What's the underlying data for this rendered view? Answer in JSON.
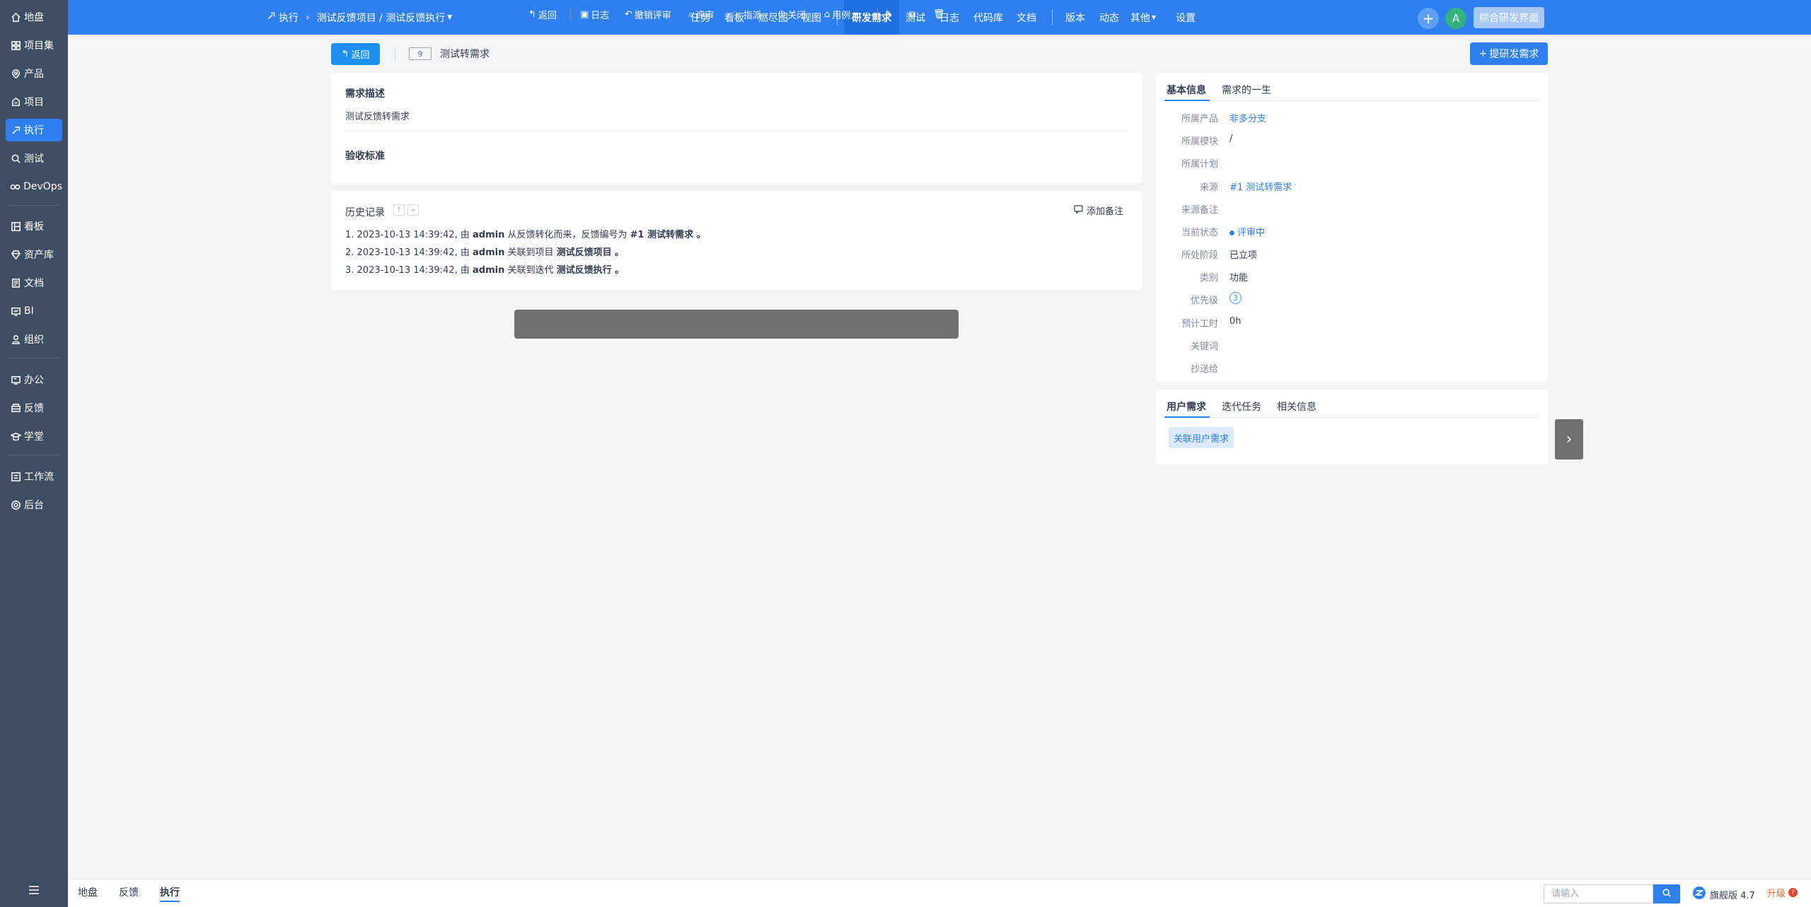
{
  "sidebar": {
    "items": [
      {
        "label": "地盘",
        "icon": "home-icon"
      },
      {
        "label": "项目集",
        "icon": "program-icon"
      },
      {
        "label": "产品",
        "icon": "product-icon"
      },
      {
        "label": "项目",
        "icon": "project-icon"
      },
      {
        "label": "执行",
        "icon": "execution-icon",
        "active": true
      },
      {
        "label": "测试",
        "icon": "test-icon"
      },
      {
        "label": "DevOps",
        "icon": "devops-icon"
      },
      {
        "label": "看板",
        "icon": "kanban-icon"
      },
      {
        "label": "资产库",
        "icon": "asset-icon"
      },
      {
        "label": "文档",
        "icon": "doc-icon"
      },
      {
        "label": "BI",
        "icon": "bi-icon"
      },
      {
        "label": "组织",
        "icon": "org-icon"
      },
      {
        "label": "办公",
        "icon": "office-icon"
      },
      {
        "label": "反馈",
        "icon": "feedback-icon"
      },
      {
        "label": "学堂",
        "icon": "academy-icon"
      },
      {
        "label": "工作流",
        "icon": "workflow-icon"
      },
      {
        "label": "后台",
        "icon": "admin-icon"
      }
    ]
  },
  "header": {
    "breadcrumb": {
      "module": "执行",
      "path": "测试反馈项目 / 测试反馈执行"
    },
    "nav": [
      "任务",
      "看板",
      "燃尽图",
      "视图",
      "研发需求",
      "测试",
      "日志",
      "代码库",
      "文档",
      "版本",
      "动态",
      "其他",
      "设置"
    ],
    "active_nav": "研发需求",
    "avatar_letter": "A",
    "switch_label": "综合研发界面"
  },
  "toolbar": {
    "back_label": "返回",
    "story_id": "9",
    "story_title": "测试转需求",
    "create_label": "提研发需求"
  },
  "story": {
    "desc_title": "需求描述",
    "desc_text": "测试反馈转需求",
    "verify_title": "验收标准"
  },
  "history": {
    "title": "历史记录",
    "add_note": "添加备注",
    "entries": [
      {
        "prefix": "1. 2023-10-13 14:39:42, 由 ",
        "actor": "admin",
        "action": " 从反馈转化而来，反馈编号为 ",
        "object": "#1 测试转需求 。"
      },
      {
        "prefix": "2. 2023-10-13 14:39:42, 由 ",
        "actor": "admin",
        "action": " 关联到项目 ",
        "object": "测试反馈项目 。"
      },
      {
        "prefix": "3. 2023-10-13 14:39:42, 由 ",
        "actor": "admin",
        "action": " 关联到迭代 ",
        "object": "测试反馈执行 。"
      }
    ]
  },
  "actions": {
    "back": "返回",
    "log": "日志",
    "revoke_review": "撤销评审",
    "review": "评审",
    "assign": "指派",
    "close": "关闭",
    "case": "用例"
  },
  "info": {
    "tabs": [
      "基本信息",
      "需求的一生"
    ],
    "fields": [
      {
        "label": "所属产品",
        "value": "非多分支",
        "type": "link"
      },
      {
        "label": "所属模块",
        "value": "/",
        "type": "text"
      },
      {
        "label": "所属计划",
        "value": "",
        "type": "text"
      },
      {
        "label": "来源",
        "value": "#1 测试转需求",
        "type": "link"
      },
      {
        "label": "来源备注",
        "value": "",
        "type": "text"
      },
      {
        "label": "当前状态",
        "value": "评审中",
        "type": "status"
      },
      {
        "label": "所处阶段",
        "value": "已立项",
        "type": "text"
      },
      {
        "label": "类别",
        "value": "功能",
        "type": "text"
      },
      {
        "label": "优先级",
        "value": "3",
        "type": "priority"
      },
      {
        "label": "预计工时",
        "value": "0h",
        "type": "text"
      },
      {
        "label": "关键词",
        "value": "",
        "type": "text"
      },
      {
        "label": "抄送给",
        "value": "",
        "type": "text"
      }
    ]
  },
  "related": {
    "tabs": [
      "用户需求",
      "迭代任务",
      "相关信息"
    ],
    "link_label": "关联用户需求"
  },
  "bottom": {
    "links": [
      "地盘",
      "反馈",
      "执行"
    ],
    "active": "执行",
    "search_placeholder": "请输入",
    "version": "旗舰版 4.7",
    "upgrade": "升级"
  },
  "colors": {
    "primary": "#2e7ff0",
    "sidebar_bg": "#3e4e62",
    "action_bar": "#6f6f6f",
    "avatar": "#34b37e"
  }
}
